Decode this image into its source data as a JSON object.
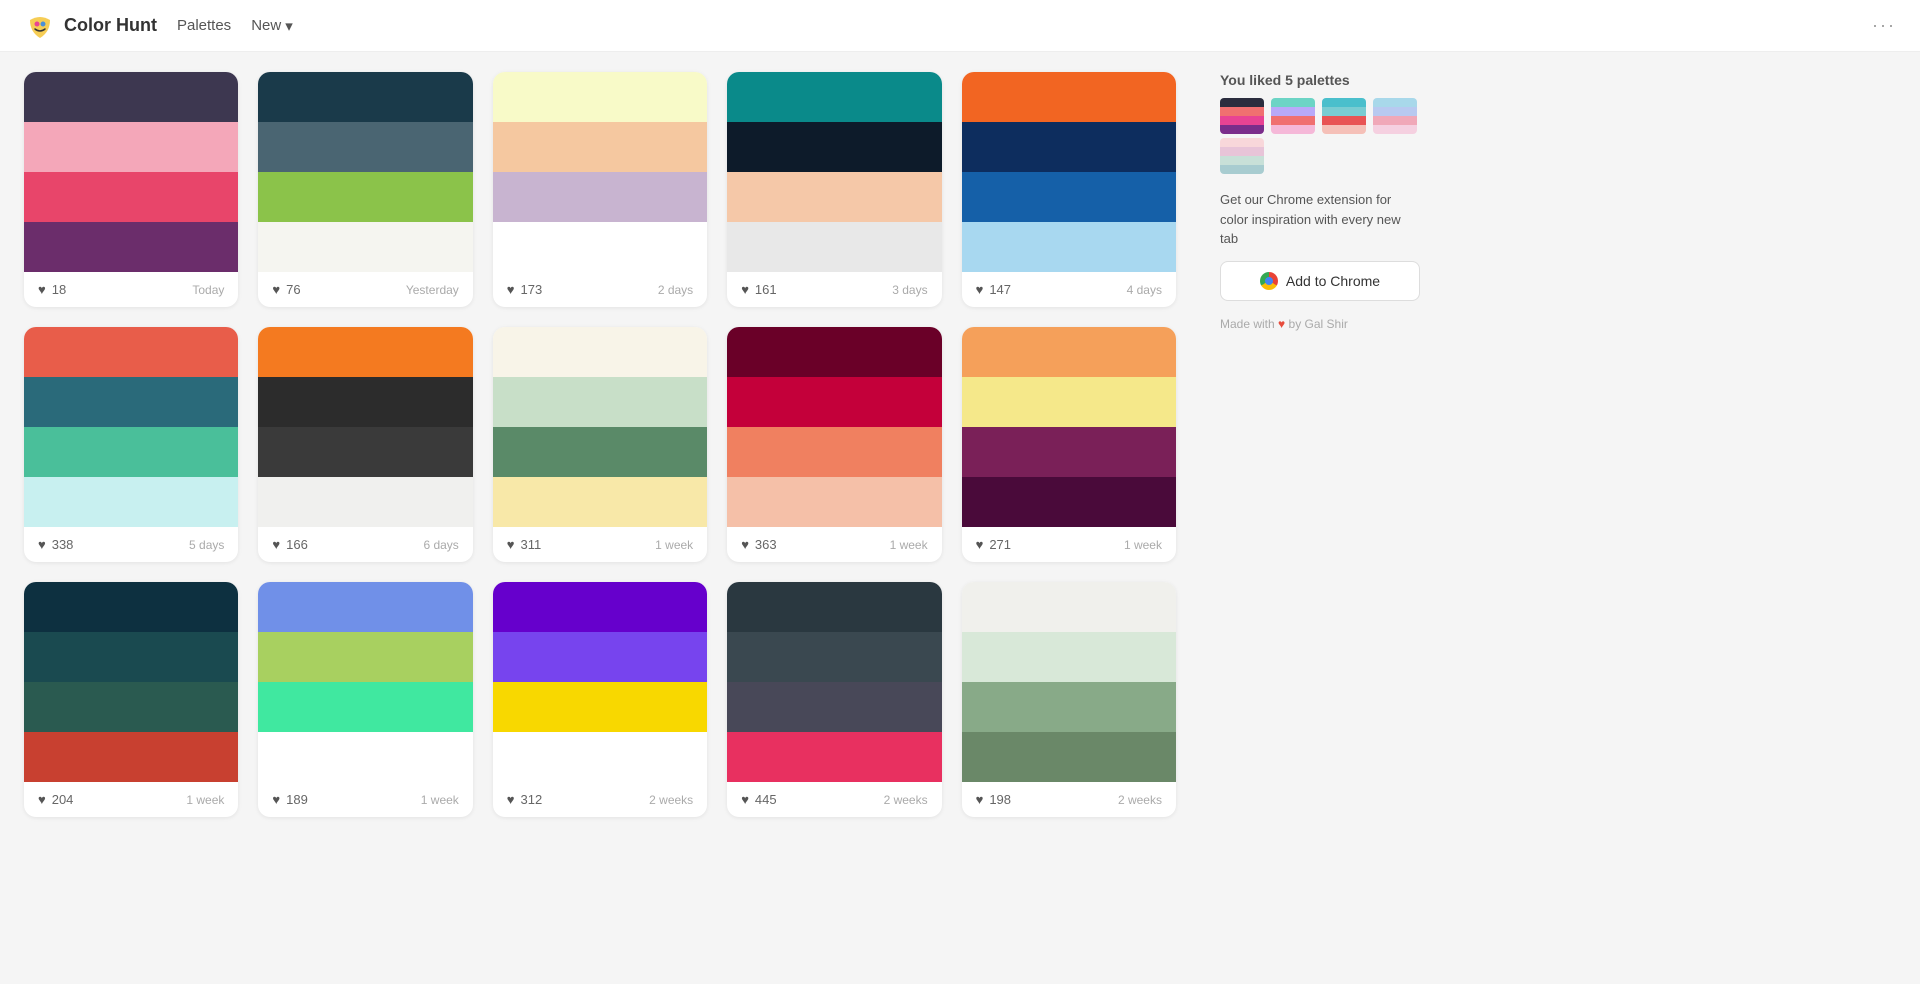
{
  "header": {
    "logo_text": "Color Hunt",
    "nav_palettes": "Palettes",
    "nav_new": "New",
    "dots": "···"
  },
  "sidebar": {
    "liked_label": "You liked",
    "liked_count": "5",
    "liked_suffix": "palettes",
    "chrome_ext_text": "Get our Chrome extension for color inspiration with every new tab",
    "chrome_btn_label": "Add to Chrome",
    "made_with": "Made with",
    "made_by": "by Gal Shir",
    "liked_palettes": [
      {
        "colors": [
          "#2b2d3e",
          "#f07070",
          "#e84393",
          "#7b2d8b"
        ]
      },
      {
        "colors": [
          "#6cd4c5",
          "#b8a9f8",
          "#f07070",
          "#f5b8d8"
        ]
      },
      {
        "colors": [
          "#4abfcc",
          "#79ccd2",
          "#e85454",
          "#f5c0b8"
        ]
      },
      {
        "colors": [
          "#a8d8ea",
          "#b8c9f0",
          "#f0a8b8",
          "#f5d0e0"
        ]
      },
      {
        "colors": [
          "#f8d7da",
          "#e8c4d8",
          "#c8e0d8",
          "#a8ccd0"
        ]
      }
    ]
  },
  "palettes": [
    {
      "colors": [
        "#3d3750",
        "#f4a7b9",
        "#e8456a",
        "#6b2d6b"
      ],
      "likes": 18,
      "date": "Today"
    },
    {
      "colors": [
        "#1a3a4a",
        "#4a6572",
        "#8bc34a",
        "#f5f5f0"
      ],
      "likes": 76,
      "date": "Yesterday"
    },
    {
      "colors": [
        "#f8fac8",
        "#f5c8a0",
        "#c8b4d0",
        "#ffffff"
      ],
      "likes": 173,
      "date": "2 days"
    },
    {
      "colors": [
        "#0a8a8a",
        "#0d1b2a",
        "#f5c8a8",
        "#e8e8e8"
      ],
      "likes": 161,
      "date": "3 days"
    },
    {
      "colors": [
        "#f26522",
        "#0d2d5e",
        "#1560a8",
        "#a8d8f0"
      ],
      "likes": 147,
      "date": "4 days"
    },
    {
      "colors": [
        "#e85d4a",
        "#2a6a7a",
        "#4abf9a",
        "#c8f0f0"
      ],
      "likes": 338,
      "date": "5 days"
    },
    {
      "colors": [
        "#f47a20",
        "#2c2c2c",
        "#3a3a3a",
        "#f0f0ee"
      ],
      "likes": 166,
      "date": "6 days"
    },
    {
      "colors": [
        "#f8f4e8",
        "#c8dfc8",
        "#5a8a68",
        "#f8e8a8"
      ],
      "likes": 311,
      "date": "1 week"
    },
    {
      "colors": [
        "#6a0028",
        "#c4003a",
        "#f08060",
        "#f5c0a8"
      ],
      "likes": 363,
      "date": "1 week"
    },
    {
      "colors": [
        "#f5a05a",
        "#f5e88a",
        "#7a2058",
        "#4a0a3a"
      ],
      "likes": 271,
      "date": "1 week"
    },
    {
      "colors": [
        "#0d3040",
        "#1a4a50",
        "#2a5a50",
        "#c84030"
      ],
      "likes": 204,
      "date": "1 week"
    },
    {
      "colors": [
        "#7090e8",
        "#a8d060",
        "#40e8a0",
        "#ffffff"
      ],
      "likes": 189,
      "date": "1 week"
    },
    {
      "colors": [
        "#6600cc",
        "#7744ee",
        "#f8d800",
        "#ffffff"
      ],
      "likes": 312,
      "date": "2 weeks"
    },
    {
      "colors": [
        "#2a3840",
        "#3a4850",
        "#484858",
        "#e83060"
      ],
      "likes": 445,
      "date": "2 weeks"
    },
    {
      "colors": [
        "#f0f0ec",
        "#d8e8d8",
        "#88aa88",
        "#6a8868"
      ],
      "likes": 198,
      "date": "2 weeks"
    }
  ]
}
